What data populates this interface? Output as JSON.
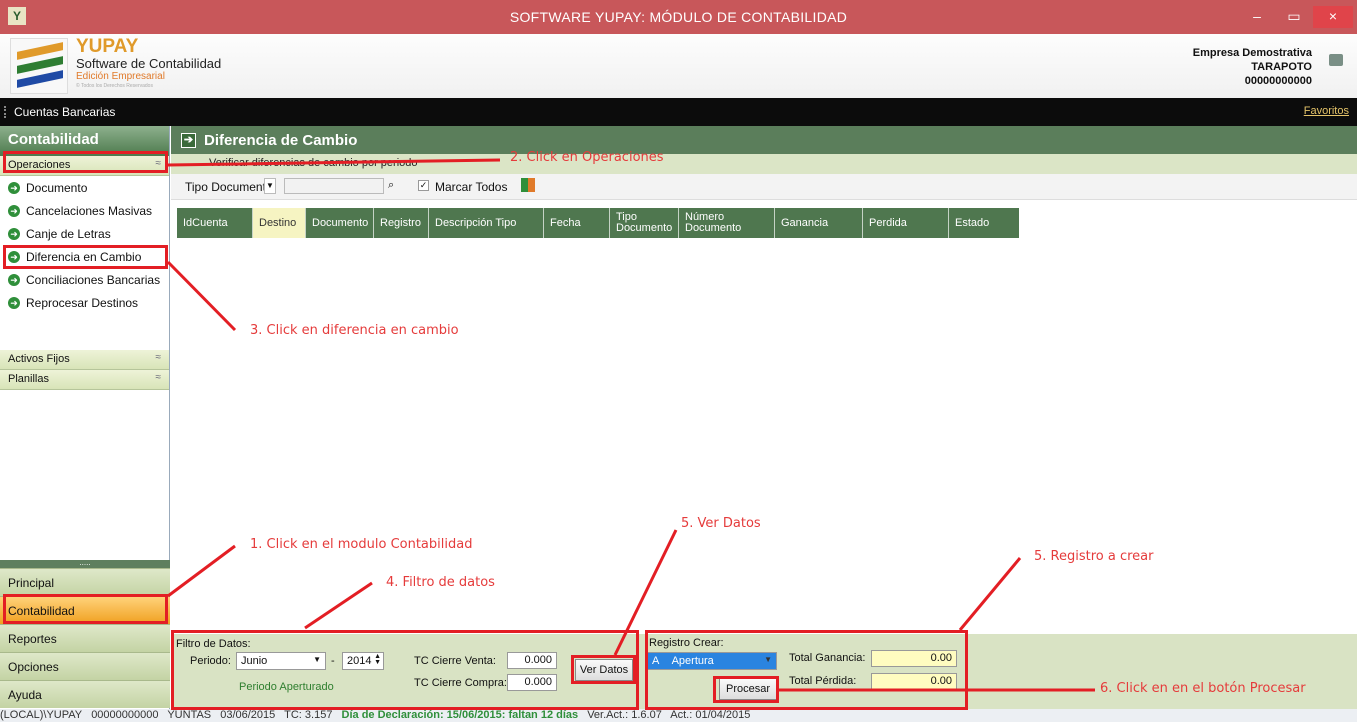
{
  "window": {
    "title": "SOFTWARE YUPAY: MÓDULO DE CONTABILIDAD",
    "icon_letter": "Y",
    "min": "–",
    "max": "▭",
    "close": "×"
  },
  "brand": {
    "name": "YUPAY",
    "sub": "Software de Contabilidad",
    "edition": "Edición Empresarial",
    "copyright": "© Todos los Derechos Reservados"
  },
  "company": {
    "name": "Empresa Demostrativa",
    "city": "TARAPOTO",
    "ruc": "00000000000"
  },
  "menubar": {
    "label": "Cuentas Bancarias",
    "favorites": "Favoritos"
  },
  "sidebar": {
    "header": "Contabilidad",
    "operaciones": "Operaciones",
    "items": [
      "Documento",
      "Cancelaciones Masivas",
      "Canje de Letras",
      "Diferencia en Cambio",
      "Conciliaciones Bancarias",
      "Reprocesar Destinos"
    ],
    "activos": "Activos Fijos",
    "planillas": "Planillas",
    "modules": [
      "Principal",
      "Contabilidad",
      "Reportes",
      "Opciones",
      "Ayuda"
    ]
  },
  "panel": {
    "title": "Diferencia de Cambio",
    "subtitle": "Verificar diferencias de cambio por periodo"
  },
  "toolbar": {
    "tipo_label": "Tipo Documentc",
    "marcar": "Marcar Todos"
  },
  "grid": {
    "columns": [
      "IdCuenta",
      "Destino",
      "Documento",
      "Registro",
      "Descripción Tipo",
      "Fecha",
      "Tipo Documento",
      "Número Documento",
      "Ganancia",
      "Perdida",
      "Estado"
    ]
  },
  "filter": {
    "title": "Filtro de Datos:",
    "periodo_label": "Periodo:",
    "month": "Junio",
    "dash": "-",
    "year": "2014",
    "status": "Periodo Aperturado",
    "tc_venta_label": "TC Cierre Venta:",
    "tc_venta": "0.000",
    "tc_compra_label": "TC Cierre Compra:",
    "tc_compra": "0.000",
    "ver_datos": "Ver Datos"
  },
  "registro": {
    "title": "Registro Crear:",
    "code": "A",
    "value": "Apertura",
    "ganancia_label": "Total Ganancia:",
    "ganancia": "0.00",
    "perdida_label": "Total Pérdida:",
    "perdida": "0.00",
    "procesar": "Procesar"
  },
  "statusbar": {
    "server": "(LOCAL)\\YUPAY",
    "ruc": "00000000000",
    "user": "YUNTAS",
    "date": "03/06/2015",
    "tc": "TC: 3.157",
    "declaracion": "Día de Declaración: 15/06/2015: faltan 12 días",
    "ver": "Ver.Act.: 1.6.07",
    "act": "Act.: 01/04/2015"
  },
  "annotations": {
    "a1": "1. Click en el modulo Contabilidad",
    "a2": "2. Click en Operaciones",
    "a3": "3. Click en diferencia en cambio",
    "a4": "4. Filtro de datos",
    "a5": "5. Ver Datos",
    "a5b": "5. Registro a crear",
    "a6": "6. Click en en el botón Procesar"
  }
}
